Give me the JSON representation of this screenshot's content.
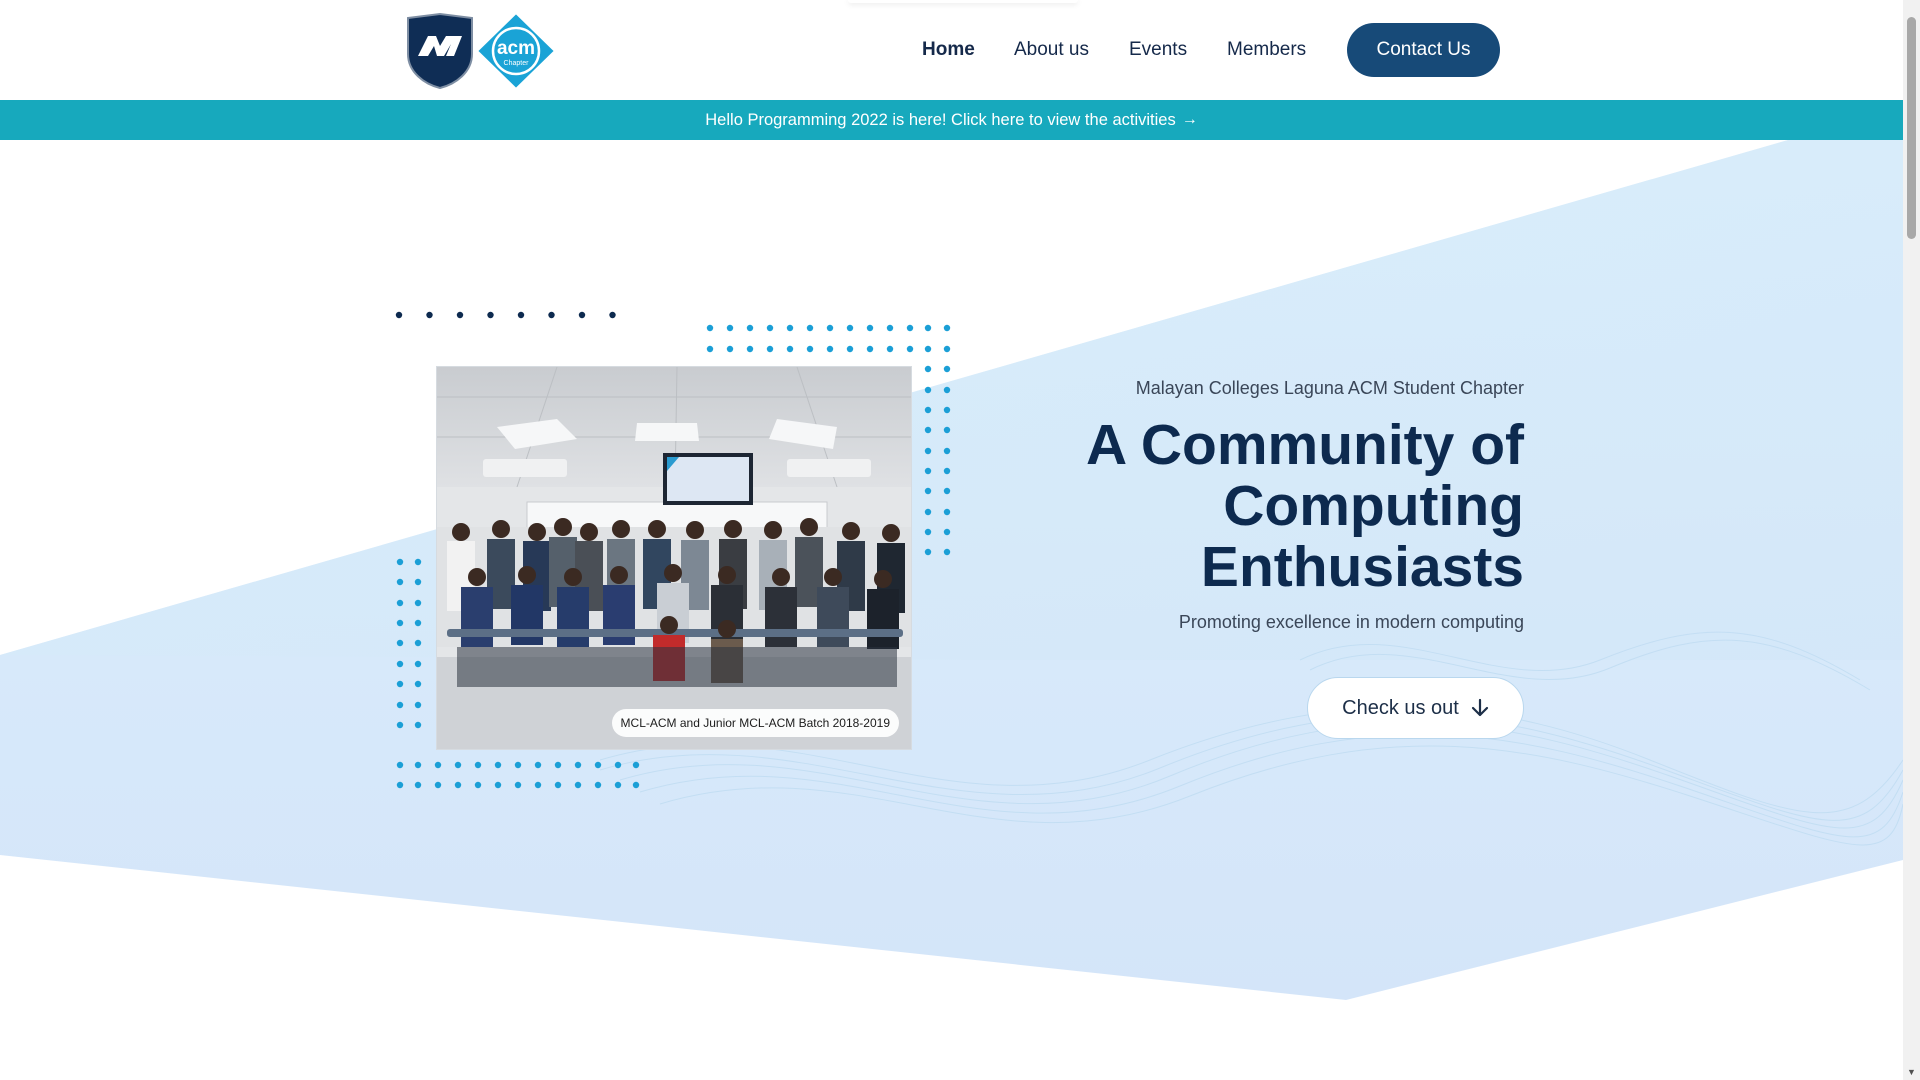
{
  "nav": {
    "items": [
      {
        "label": "Home",
        "active": true
      },
      {
        "label": "About us",
        "active": false
      },
      {
        "label": "Events",
        "active": false
      },
      {
        "label": "Members",
        "active": false
      }
    ],
    "contact_label": "Contact Us"
  },
  "logos": {
    "school_logo_text": "M",
    "acm_logo_text": "acm",
    "acm_logo_subtext": "Chapter"
  },
  "banner": {
    "text": "Hello Programming 2022 is here! Click here to view the activities",
    "icon": "arrow-right-icon"
  },
  "hero": {
    "subtitle": "Malayan Colleges Laguna ACM Student Chapter",
    "title_lines": [
      "A Community of",
      "Computing",
      "Enthusiasts"
    ],
    "tagline": "Promoting excellence in modern computing",
    "cta_label": "Check us out",
    "cta_icon": "arrow-down-icon"
  },
  "photo": {
    "caption": "MCL-ACM and Junior MCL-ACM Batch 2018-2019"
  },
  "colors": {
    "navy": "#0d2a4f",
    "banner_teal": "#17a9bd",
    "button_blue": "#174a78",
    "dot_blue": "#1b9fd6",
    "hero_light": "#dbeffa"
  }
}
